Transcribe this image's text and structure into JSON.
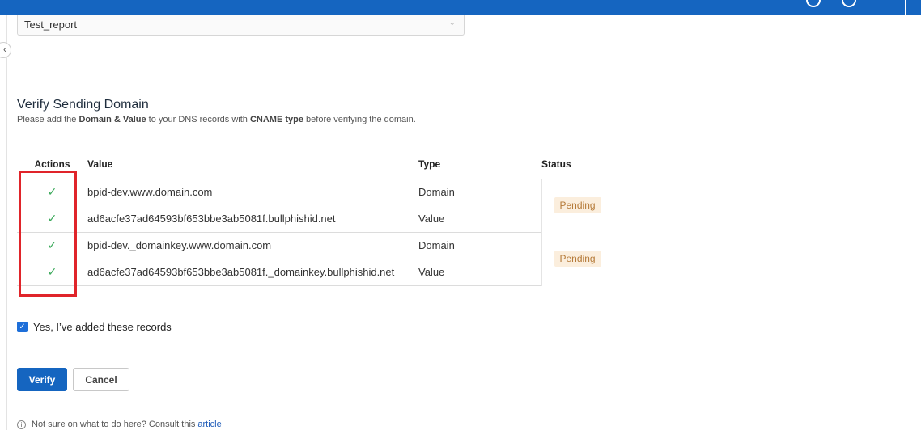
{
  "header": {
    "bg_color": "#1565c0"
  },
  "form": {
    "report_select_value": "Test_report"
  },
  "section": {
    "title": "Verify Sending Domain",
    "desc_prefix": "Please add the ",
    "desc_bold1": "Domain & Value",
    "desc_mid": " to your DNS records with ",
    "desc_bold2": "CNAME type",
    "desc_suffix": " before verifying the domain."
  },
  "table": {
    "headers": {
      "actions": "Actions",
      "value": "Value",
      "type": "Type",
      "status": "Status"
    },
    "groups": [
      {
        "status": "Pending",
        "rows": [
          {
            "action": "✓",
            "value": "bpid-dev.www.domain.com",
            "type": "Domain"
          },
          {
            "action": "✓",
            "value": "ad6acfe37ad64593bf653bbe3ab5081f.bullphishid.net",
            "type": "Value"
          }
        ]
      },
      {
        "status": "Pending",
        "rows": [
          {
            "action": "✓",
            "value": "bpid-dev._domainkey.www.domain.com",
            "type": "Domain"
          },
          {
            "action": "✓",
            "value": "ad6acfe37ad64593bf653bbe3ab5081f._domainkey.bullphishid.net",
            "type": "Value"
          }
        ]
      }
    ]
  },
  "confirm": {
    "label": "Yes, I’ve added these records",
    "checked": true
  },
  "buttons": {
    "verify": "Verify",
    "cancel": "Cancel"
  },
  "help": {
    "text": "Not sure on what to do here? Consult this",
    "link": "article"
  },
  "colors": {
    "accent": "#1565c0",
    "success": "#3daa5c",
    "pending_bg": "#fbeedd",
    "highlight": "#e0242a"
  }
}
